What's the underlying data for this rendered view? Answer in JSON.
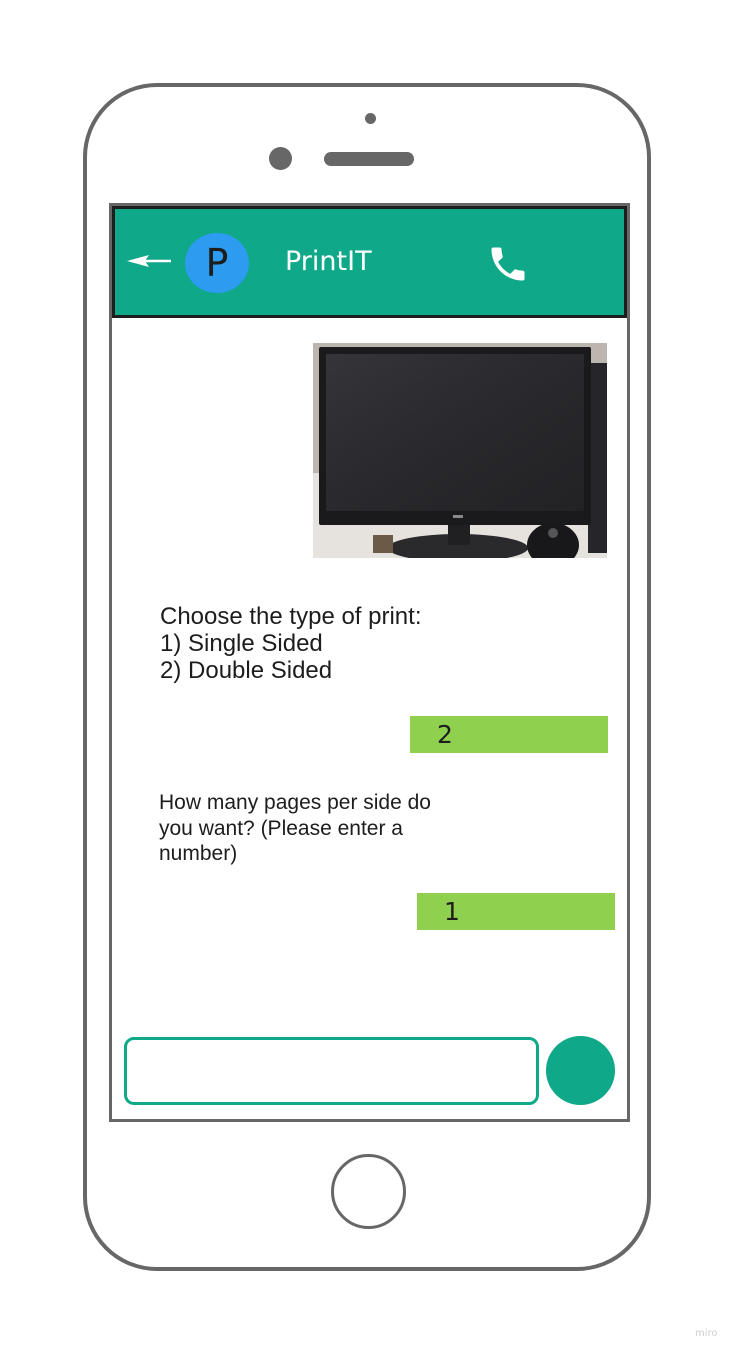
{
  "chat": {
    "contact_initial": "P",
    "contact_name": "PrintIT"
  },
  "messages": {
    "image_icon": "photo-of-monitor",
    "bot_1": "Choose the type of print:\n1) Single Sided\n2) Double Sided",
    "reply_1": "2",
    "bot_2": "How many pages per side do you want? (Please enter a number)",
    "reply_2": "1"
  },
  "composer": {
    "input_value": "",
    "send_icon": "send-button-circle"
  },
  "colors": {
    "header": "#0fa888",
    "avatar": "#2d9bf0",
    "user_bubble": "#8fd14f",
    "device_frame": "#676767"
  },
  "icons": {
    "back": "back-arrow-icon",
    "call": "phone-call-icon"
  },
  "watermark": "miro"
}
